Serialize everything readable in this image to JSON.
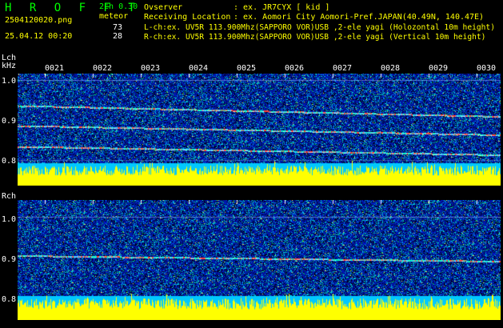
{
  "header": {
    "brand": "H R O F F T",
    "mode": "2ch 0.30",
    "filename": "2504120020.png",
    "event_label": "meteor",
    "event_count_l": "73",
    "event_count_r": "28",
    "datetime": "25.04.12 00:20",
    "observer_label": "Ovserver",
    "observer_value": ": ex. JR7CYX [ kid ]",
    "location_label": "Receiving Location",
    "location_value": ": ex. Aomori City Aomori-Pref.JAPAN(40.49N, 140.47E)",
    "lch_info": "L-ch:ex. UV5R 113.900Mhz(SAPPORO VOR)USB ,2-ele yagi (Holozontal 10m height)",
    "rch_info": "R-ch:ex. UV5R 113.900Mhz(SAPPORO VOR)USB ,2-ele yagi (Vertical 10m height)"
  },
  "time_labels": [
    "0021",
    "0022",
    "0023",
    "0024",
    "0025",
    "0026",
    "0027",
    "0028",
    "0029",
    "0030"
  ],
  "lch": {
    "title": "Lch",
    "unit": "kHz",
    "y_labels": [
      "1.0",
      "0.9",
      "0.8"
    ],
    "traces": [
      {
        "start_khz": 0.935,
        "end_khz": 0.908
      },
      {
        "start_khz": 0.885,
        "end_khz": 0.862
      },
      {
        "start_khz": 0.833,
        "end_khz": 0.812
      }
    ]
  },
  "rch": {
    "title": "Rch",
    "unit": "kHz",
    "y_labels": [
      "1.0",
      "0.9",
      "0.8"
    ],
    "traces": [
      {
        "start_khz": 0.902,
        "end_khz": 0.888
      }
    ]
  },
  "colors": {
    "background": "#000000",
    "noise_floor": "#0a1f9c",
    "trace_hot": "#ff4030",
    "level_bar": "#ffff00",
    "level_base": "#00c8ff",
    "text_green": "#00ff00",
    "text_yellow": "#ffff00",
    "text_white": "#ffffff"
  }
}
